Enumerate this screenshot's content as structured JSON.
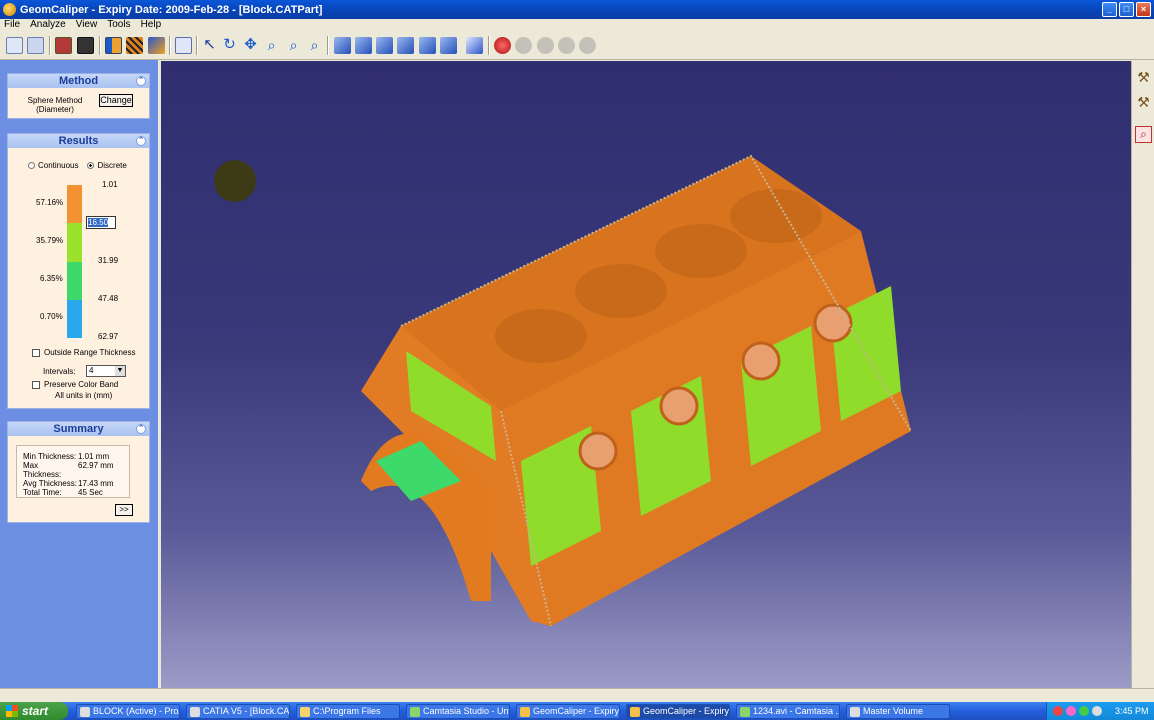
{
  "window": {
    "title": "GeomCaliper  -  Expiry Date: 2009-Feb-28  - [Block.CATPart]"
  },
  "menu": [
    "File",
    "Analyze",
    "View",
    "Tools",
    "Help"
  ],
  "method": {
    "title": "Method",
    "name_line1": "Sphere Method",
    "name_line2": "(Diameter)",
    "change_label": "Change"
  },
  "results": {
    "title": "Results",
    "continuous_label": "Continuous",
    "discrete_label": "Discrete",
    "mode_selected": "Discrete",
    "percents": [
      "57.16%",
      "35.79%",
      "6.35%",
      "0.70%"
    ],
    "values": [
      "1.01",
      "16.50",
      "31.99",
      "47.48",
      "62.97"
    ],
    "band_colors": [
      "#f39230",
      "#9be22b",
      "#3ed96b",
      "#2aa8ee"
    ],
    "outside_range_label": "Outside Range Thickness",
    "intervals_label": "Intervals:",
    "intervals_value": "4",
    "preserve_label": "Preserve Color Band",
    "units_label": "All units in (mm)"
  },
  "summary": {
    "title": "Summary",
    "rows": [
      {
        "label": "Min Thickness:",
        "value": "1.01 mm"
      },
      {
        "label": "Max Thickness:",
        "value": "62.97 mm"
      },
      {
        "label": "Avg Thickness:",
        "value": "17.43 mm"
      },
      {
        "label": "Total Time:",
        "value": "45 Sec"
      }
    ],
    "more_label": ">>"
  },
  "taskbar": {
    "start_label": "start",
    "tasks": [
      "BLOCK (Active) - Pro/...",
      "CATIA V5 - [Block.CA...",
      "C:\\Program Files",
      "Camtasia Studio - Unt...",
      "GeomCaliper - Expiry...",
      "GeomCaliper - Expiry...",
      "1234.avi - Camtasia ...",
      "Master Volume"
    ],
    "active_task": 5,
    "clock": "3:45 PM"
  },
  "colors": {
    "viewport_top": "#2f2e70",
    "viewport_bottom": "#9c9cc8",
    "part_orange": "#e27a20",
    "part_green": "#8fdc2a"
  }
}
